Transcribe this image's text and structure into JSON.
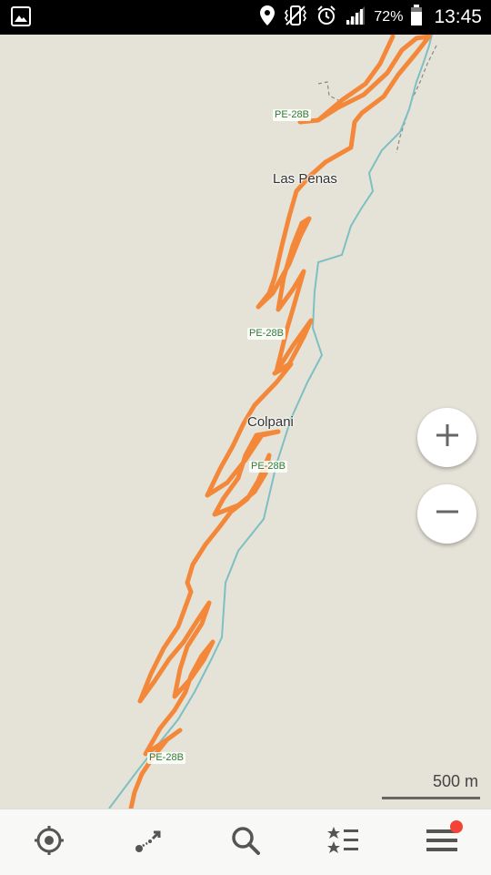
{
  "status_bar": {
    "battery_percent": "72%",
    "time": "13:45",
    "icons": [
      "gallery-icon",
      "location-icon",
      "vibrate-icon",
      "alarm-icon",
      "signal-icon",
      "battery-icon"
    ]
  },
  "map": {
    "places": [
      {
        "name": "Las Penas"
      },
      {
        "name": "Colpani"
      }
    ],
    "route_shields": [
      "PE-28B",
      "PE-28B",
      "PE-28B",
      "PE-28B"
    ],
    "colors": {
      "background": "#e5e3d8",
      "road": "#f4883a",
      "river": "#7dbfc3",
      "trail": "#888888"
    }
  },
  "controls": {
    "zoom_in_icon": "plus-icon",
    "zoom_out_icon": "minus-icon"
  },
  "scale": {
    "label": "500 m"
  },
  "bottom_nav": {
    "items": [
      "my-location",
      "route",
      "search",
      "bookmarks",
      "menu"
    ],
    "notification_dot_color": "#f44336"
  }
}
